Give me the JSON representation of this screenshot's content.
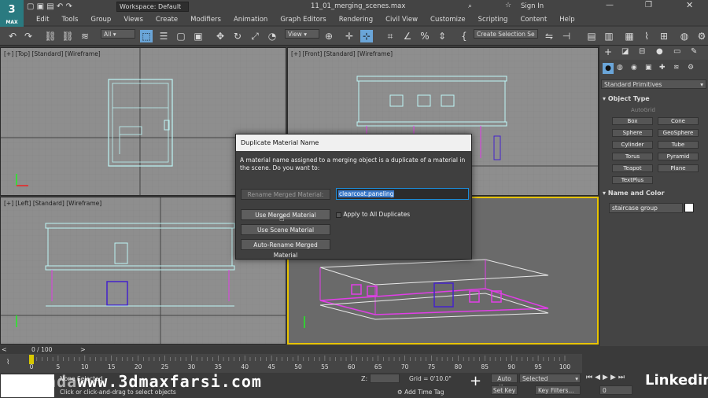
{
  "app": {
    "logo": "3",
    "logo_sub": "MAX",
    "workspace": "Workspace: Default",
    "file_title": "11_01_merging_scenes.max",
    "sign_in": "Sign In"
  },
  "menu": [
    "Edit",
    "Tools",
    "Group",
    "Views",
    "Create",
    "Modifiers",
    "Animation",
    "Graph Editors",
    "Rendering",
    "Civil View",
    "Customize",
    "Scripting",
    "Content",
    "Help"
  ],
  "toolbar": {
    "filter": "All",
    "view": "View",
    "selection_set": "Create Selection Se"
  },
  "viewports": [
    {
      "label": "[+] [Top] [Standard] [Wireframe]"
    },
    {
      "label": "[+] [Front] [Standard] [Wireframe]"
    },
    {
      "label": "[+] [Left] [Standard] [Wireframe]"
    }
  ],
  "command_panel": {
    "category": "Standard Primitives",
    "object_type_header": "Object Type",
    "autogrid": "AutoGrid",
    "buttons": [
      "Box",
      "Cone",
      "Sphere",
      "GeoSphere",
      "Cylinder",
      "Tube",
      "Torus",
      "Pyramid",
      "Teapot",
      "Plane",
      "TextPlus"
    ],
    "name_color_header": "Name and Color",
    "object_name": "staircase group"
  },
  "dialog": {
    "title": "Duplicate Material Name",
    "message": "A material name assigned to a merging object is a duplicate of a material in the scene. Do you want to:",
    "rename_button": "Rename Merged Material:",
    "rename_value": "clearcoat.paneling",
    "use_merged": "Use Merged Material",
    "apply_all": "Apply to All Duplicates",
    "use_scene": "Use Scene Material",
    "auto_rename": "Auto-Rename Merged Material"
  },
  "timeline": {
    "frame": "0 / 100",
    "ticks": [
      "0",
      "5",
      "10",
      "15",
      "20",
      "25",
      "30",
      "35",
      "40",
      "45",
      "50",
      "55",
      "60",
      "65",
      "70",
      "75",
      "80",
      "85",
      "90",
      "95",
      "100"
    ]
  },
  "status": {
    "selected": "None Selected",
    "prompt": "Click or click-and-drag to select objects",
    "z_label": "Z:",
    "grid": "Grid = 0'10.0\"",
    "add_time_tag": "Add Time Tag",
    "auto_key": "Auto Key",
    "selected_dd": "Selected",
    "set_key": "Set Key",
    "key_filters": "Key Filters...",
    "frame_field": "0"
  },
  "overlays": {
    "watermark": "www.3dmaxfarsi.com",
    "watermark_prefix": "lynda",
    "linkedin": "Linkedin"
  }
}
